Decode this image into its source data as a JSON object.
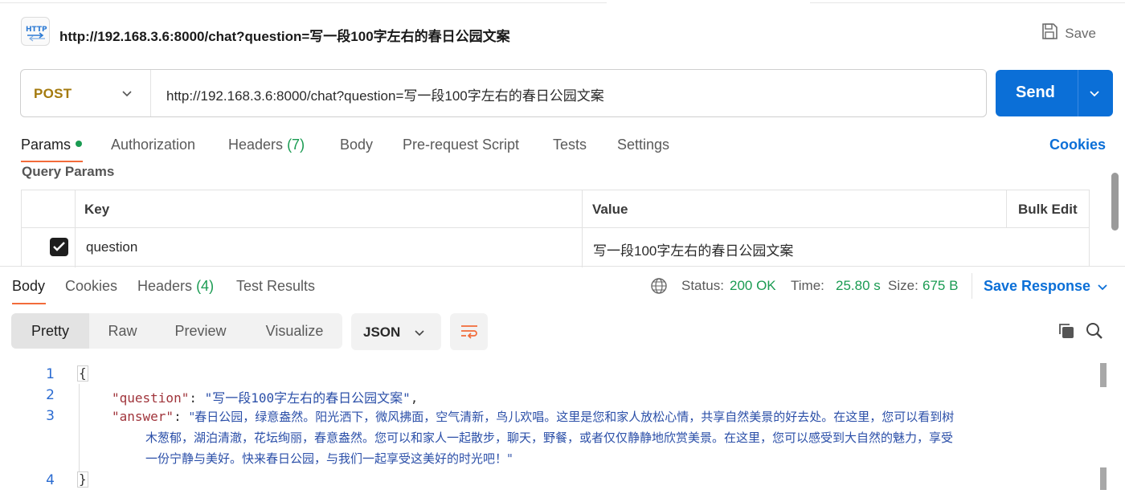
{
  "request": {
    "title": "http://192.168.3.6:8000/chat?question=写一段100字左右的春日公园文案",
    "save_label": "Save",
    "method": "POST",
    "url": "http://192.168.3.6:8000/chat?question=写一段100字左右的春日公园文案",
    "send_label": "Send"
  },
  "request_tabs": {
    "params": "Params",
    "authorization": "Authorization",
    "headers": "Headers",
    "headers_count": "(7)",
    "body": "Body",
    "prerequest": "Pre-request Script",
    "tests": "Tests",
    "settings": "Settings",
    "cookies": "Cookies"
  },
  "query_params": {
    "section_label": "Query Params",
    "columns": [
      "Key",
      "Value",
      "Bulk Edit"
    ],
    "rows": [
      {
        "checked": true,
        "key": "question",
        "value": "写一段100字左右的春日公园文案"
      }
    ]
  },
  "response_tabs": {
    "body": "Body",
    "cookies": "Cookies",
    "headers": "Headers",
    "headers_count": "(4)",
    "test_results": "Test Results",
    "status_label": "Status:",
    "status_value": "200 OK",
    "time_label": "Time:",
    "time_value": "25.80 s",
    "size_label": "Size:",
    "size_value": "675 B",
    "save_response": "Save Response"
  },
  "view_modes": [
    "Pretty",
    "Raw",
    "Preview",
    "Visualize"
  ],
  "format": "JSON",
  "code": {
    "line_numbers": [
      "1",
      "2",
      "3",
      "4"
    ],
    "open_brace": "{",
    "close_brace": "}",
    "q_key": "\"question\"",
    "q_value": "\"写一段100字左右的春日公园文案\"",
    "a_key": "\"answer\"",
    "a_value_line1": "\"春日公园，绿意盎然。阳光洒下，微风拂面，空气清新，鸟儿欢唱。这里是您和家人放松心情，共享自然美景的好去处。在这里，您可以看到树",
    "a_value_line2": "木葱郁，湖泊清澈，花坛绚丽，春意盎然。您可以和家人一起散步，聊天，野餐，或者仅仅静静地欣赏美景。在这里，您可以感受到大自然的魅力，享受",
    "a_value_line3": "一份宁静与美好。快来春日公园，与我们一起享受这美好的时光吧！\""
  },
  "colors": {
    "send_button": "#0b6fd7",
    "method": "#a47a0e",
    "status_ok": "#1a9b52",
    "active_tab_underline": "#f26b3a",
    "json_key": "#a0343b",
    "json_string": "#2b4fa8"
  }
}
